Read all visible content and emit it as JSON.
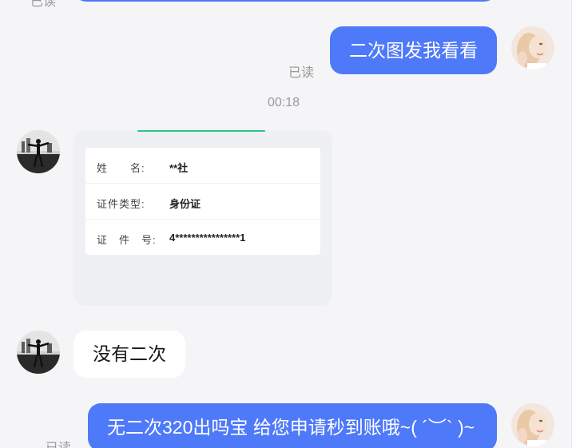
{
  "messages": {
    "top_read_partial": "已读",
    "m1_text": "二次图发我看看",
    "m1_read": "已读",
    "time": "00:18",
    "card": {
      "rows": [
        {
          "label": "姓　　名:",
          "value": "**社"
        },
        {
          "label": "证件类型:",
          "value": "身份证"
        },
        {
          "label": "证　件　号:",
          "value": "4****************1"
        }
      ]
    },
    "m2_text": "没有二次",
    "m3_text": "无二次320出吗宝 给您申请秒到账哦~( ´︶` )~",
    "m3_read": "已读"
  },
  "colors": {
    "outgoing_bubble": "#4e79f8",
    "incoming_bubble": "#ffffff",
    "background": "#f5f5f7",
    "meta_text": "#9a9a9a"
  },
  "icons": {
    "self_avatar": "woman-portrait",
    "peer_avatar": "silhouette-landscape"
  }
}
